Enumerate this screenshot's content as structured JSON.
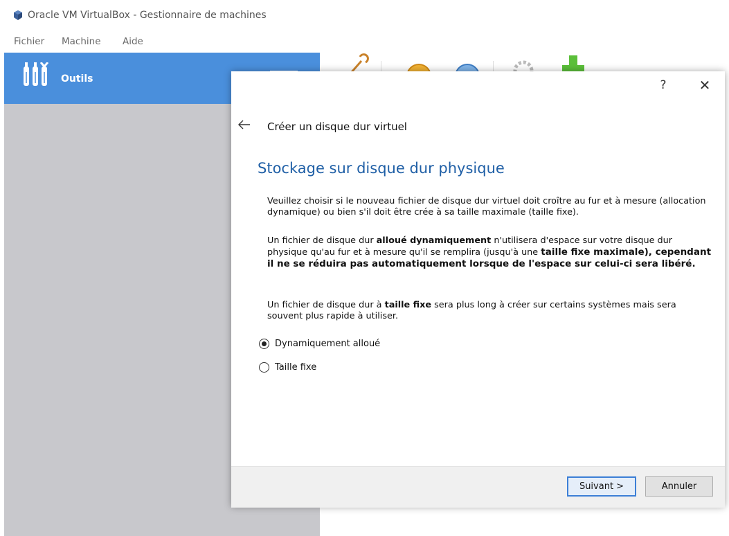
{
  "window": {
    "title": "Oracle VM VirtualBox - Gestionnaire de machines",
    "app_icon": "virtualbox-icon"
  },
  "menubar": {
    "items": [
      "Fichier",
      "Machine",
      "Aide"
    ]
  },
  "sidebar": {
    "tools_label": "Outils",
    "tools_icon": "tools-icon",
    "menu_icon": "list-menu-icon",
    "accent_color": "#4a8fdc"
  },
  "toolbar": {
    "icons": [
      "preferences-icon",
      "import-icon",
      "export-icon",
      "settings-gear-icon",
      "new-icon"
    ]
  },
  "dialog": {
    "help_label": "?",
    "close_label": "✕",
    "back_icon": "back-arrow-icon",
    "wizard_title": "Créer un disque dur virtuel",
    "heading": "Stockage sur disque dur physique",
    "paragraph1": "Veuillez choisir si le nouveau fichier de disque dur virtuel doit croître au fur et à mesure (allocation dynamique) ou bien s'il doit être crée à sa taille maximale (taille fixe).",
    "paragraph2": {
      "part1": "Un fichier de disque dur ",
      "bold1": "alloué dynamiquement",
      "part2": " n'utilisera d'espace sur votre disque dur physique qu'au fur et à mesure qu'il se remplira (jusqu'à une ",
      "bold2": "taille fixe maximale), cependant il ne se réduira pas automatiquement lorsque de l'espace sur celui-ci sera libéré."
    },
    "paragraph3": {
      "part1": "Un fichier de disque dur à ",
      "bold1": "taille fixe",
      "part2": " sera plus long à créer sur certains systèmes mais sera souvent plus rapide à utiliser."
    },
    "options": [
      {
        "label": "Dynamiquement alloué",
        "checked": true
      },
      {
        "label": "Taille fixe",
        "checked": false
      }
    ],
    "buttons": {
      "next": "Suivant >",
      "cancel": "Annuler"
    },
    "heading_color": "#1f5fa6"
  }
}
